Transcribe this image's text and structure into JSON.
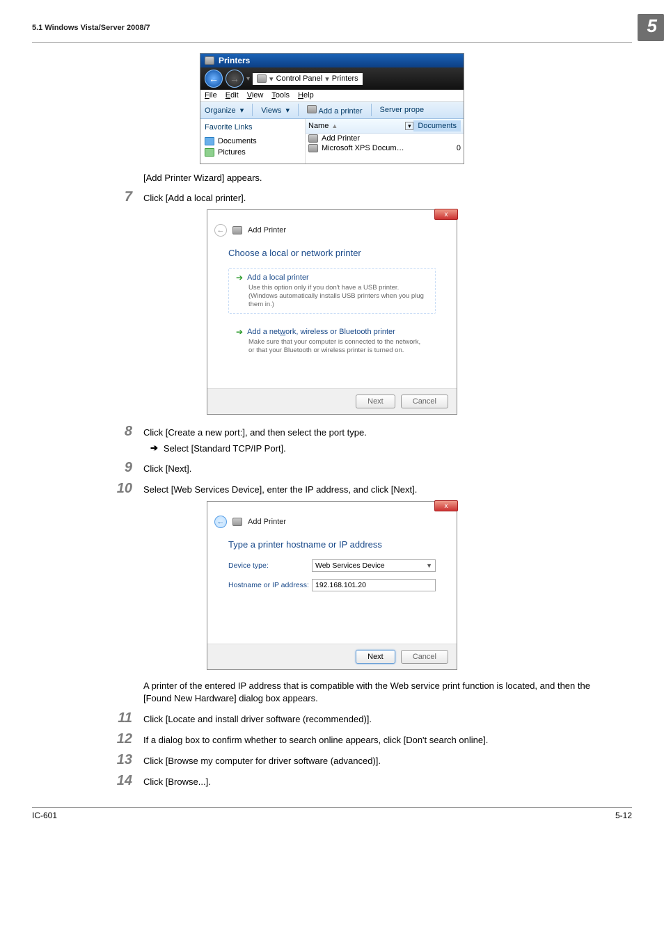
{
  "header": {
    "section_path": "5.1    Windows Vista/Server 2008/7",
    "chapter_num": "5"
  },
  "shot1": {
    "title": "Printers",
    "breadcrumb_a": "Control Panel",
    "breadcrumb_b": "Printers",
    "menu": {
      "file": "File",
      "edit": "Edit",
      "view": "View",
      "tools": "Tools",
      "help": "Help"
    },
    "toolbar": {
      "organize": "Organize",
      "views": "Views",
      "add": "Add a printer",
      "server": "Server prope"
    },
    "fav_title": "Favorite Links",
    "fav1": "Documents",
    "fav2": "Pictures",
    "col_name": "Name",
    "col_docs": "Documents",
    "row1": "Add Printer",
    "row2": "Microsoft XPS Docum…",
    "row2_count": "0"
  },
  "post_shot1_para": "[Add Printer Wizard] appears.",
  "step7_num": "7",
  "step7_text": "Click [Add a local printer].",
  "wiz1": {
    "head": "Add Printer",
    "title": "Choose a local or network printer",
    "opt1_h": "Add a local printer",
    "opt1_d": "Use this option only if you don't have a USB printer. (Windows automatically installs USB printers when you plug them in.)",
    "opt2_h": "Add a network, wireless or Bluetooth printer",
    "opt2_d": "Make sure that your computer is connected to the network, or that your Bluetooth or wireless printer is turned on.",
    "next": "Next",
    "cancel": "Cancel"
  },
  "step8_num": "8",
  "step8_text": "Click [Create a new port:], and then select the port type.",
  "step8_sub": "Select [Standard TCP/IP Port].",
  "step9_num": "9",
  "step9_text": "Click [Next].",
  "step10_num": "10",
  "step10_text": "Select [Web Services Device], enter the IP address, and click [Next].",
  "wiz2": {
    "head": "Add Printer",
    "title": "Type a printer hostname or IP address",
    "lbl_device": "Device type:",
    "val_device": "Web Services Device",
    "lbl_host": "Hostname or IP address:",
    "val_host": "192.168.101.20",
    "next": "Next",
    "cancel": "Cancel"
  },
  "after_wiz2_para": "A printer of the entered IP address that is compatible with the Web service print function is located, and then the [Found New Hardware] dialog box appears.",
  "step11_num": "11",
  "step11_text": "Click [Locate and install driver software (recommended)].",
  "step12_num": "12",
  "step12_text": "If a dialog box to confirm whether to search online appears, click [Don't search online].",
  "step13_num": "13",
  "step13_text": "Click [Browse my computer for driver software (advanced)].",
  "step14_num": "14",
  "step14_text": "Click [Browse...].",
  "footer": {
    "left": "IC-601",
    "right": "5-12"
  }
}
